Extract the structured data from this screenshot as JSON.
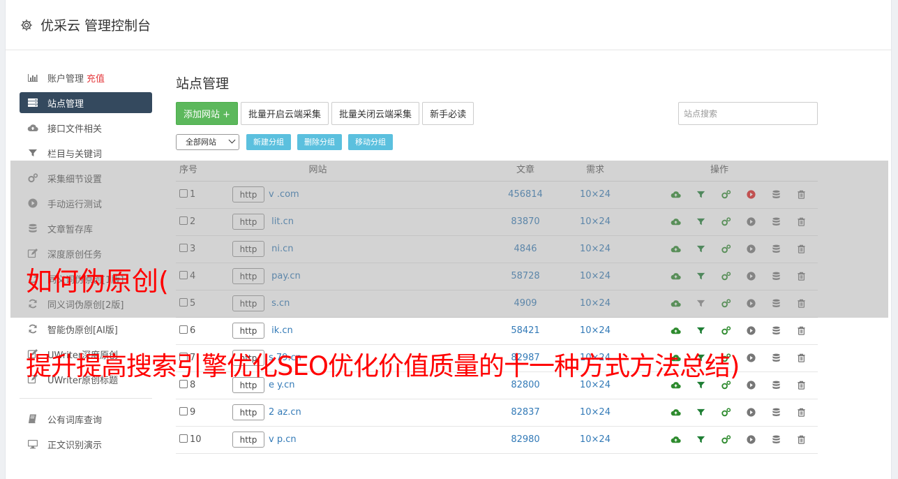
{
  "header": {
    "title": "优采云 管理控制台"
  },
  "sidebar": {
    "items": [
      {
        "label": "账户管理",
        "extra": "充值",
        "icon": "bar-chart-icon",
        "active": false
      },
      {
        "label": "站点管理",
        "icon": "server-icon",
        "active": true
      },
      {
        "label": "接口文件相关",
        "icon": "cloud-upload-icon",
        "active": false
      },
      {
        "label": "栏目与关键词",
        "icon": "filter-icon",
        "active": false
      },
      {
        "label": "采集细节设置",
        "icon": "cogs-icon",
        "active": false
      },
      {
        "label": "手动运行测试",
        "icon": "play-circle-icon",
        "active": false
      },
      {
        "label": "文章暂存库",
        "icon": "database-icon",
        "active": false
      },
      {
        "label": "深度原创任务",
        "icon": "edit-icon",
        "active": false
      },
      {
        "label": "同义词伪原创[1版]",
        "icon": "refresh-icon",
        "active": false
      },
      {
        "label": "同义词伪原创[2版]",
        "icon": "refresh-icon",
        "active": false
      },
      {
        "label": "智能伪原创[AI版]",
        "icon": "refresh-icon",
        "active": false
      },
      {
        "label": "UWriter深度原创",
        "icon": "edit-icon",
        "active": false
      },
      {
        "label": "UWriter原创标题",
        "icon": "edit-icon",
        "active": false
      }
    ],
    "bottom_items": [
      {
        "label": "公有词库查询",
        "icon": "book-icon"
      },
      {
        "label": "正文识别演示",
        "icon": "monitor-icon"
      }
    ]
  },
  "main": {
    "title": "站点管理",
    "toolbar": {
      "add_site": "添加网站 +",
      "batch_open": "批量开启云端采集",
      "batch_close": "批量关闭云端采集",
      "beginner": "新手必读",
      "search_placeholder": "站点搜索"
    },
    "group_bar": {
      "select_value": "全部网站",
      "new_group": "新建分组",
      "delete_group": "删除分组",
      "move_group": "移动分组"
    },
    "table": {
      "headers": {
        "no": "序号",
        "site": "网站",
        "articles": "文章",
        "demand": "需求",
        "ops": "操作"
      },
      "rows": [
        {
          "no": "1",
          "protocol": "http",
          "domain": "v          .com",
          "articles": "456814",
          "demand": "10×24",
          "run_active": true,
          "filter_active": true
        },
        {
          "no": "2",
          "protocol": "http",
          "domain": "     lit.cn",
          "articles": "83870",
          "demand": "10×24",
          "run_active": false,
          "filter_active": true
        },
        {
          "no": "3",
          "protocol": "http",
          "domain": "     ni.cn",
          "articles": "4846",
          "demand": "10×24",
          "run_active": false,
          "filter_active": true
        },
        {
          "no": "4",
          "protocol": "http",
          "domain": "      pay.cn",
          "articles": "58728",
          "demand": "10×24",
          "run_active": false,
          "filter_active": true
        },
        {
          "no": "5",
          "protocol": "http",
          "domain": "      s.cn",
          "articles": "4909",
          "demand": "10×24",
          "run_active": false,
          "filter_active": false
        },
        {
          "no": "6",
          "protocol": "http",
          "domain": "    ik.cn",
          "articles": "58421",
          "demand": "10×24",
          "run_active": false,
          "filter_active": true
        },
        {
          "no": "7",
          "protocol": "http",
          "domain": "s    79.cn",
          "articles": "82987",
          "demand": "10×24",
          "run_active": false,
          "filter_active": true
        },
        {
          "no": "8",
          "protocol": "http",
          "domain": "e     y.cn",
          "articles": "82800",
          "demand": "10×24",
          "run_active": false,
          "filter_active": true
        },
        {
          "no": "9",
          "protocol": "http",
          "domain": "2     az.cn",
          "articles": "82837",
          "demand": "10×24",
          "run_active": false,
          "filter_active": true
        },
        {
          "no": "10",
          "protocol": "http",
          "domain": "v     p.cn",
          "articles": "82980",
          "demand": "10×24",
          "run_active": false,
          "filter_active": true
        }
      ]
    }
  },
  "overlay": {
    "line1": "如何伪原创(",
    "line2": "提升提高搜索引擎优化SEO优化价值质量的十一种方式方法总结)"
  },
  "colors": {
    "sidebar_active": "#34495e",
    "green": "#5cb85c",
    "info": "#5bc0de",
    "link": "#337ab7",
    "overlay_text": "#ff0000"
  }
}
